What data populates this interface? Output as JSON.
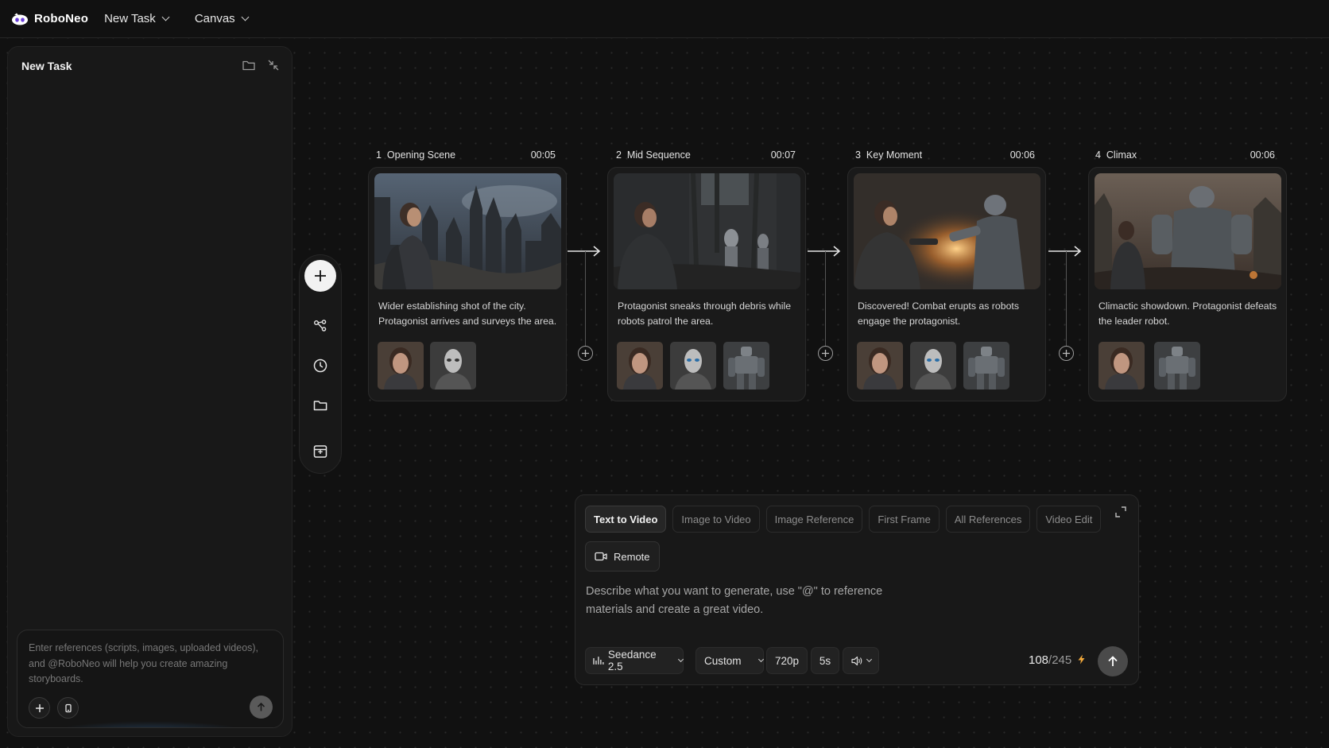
{
  "app": {
    "name": "RoboNeo",
    "menus": [
      {
        "label": "New Task"
      },
      {
        "label": "Canvas"
      }
    ]
  },
  "left_panel": {
    "title": "New Task",
    "composer_placeholder": "Enter references (scripts, images, uploaded videos), and @RoboNeo will help you create amazing storyboards."
  },
  "scenes": [
    {
      "index": "1",
      "title": "Opening Scene",
      "duration": "00:05",
      "description": "Wider establishing shot of the city. Protagonist arrives and surveys the area.",
      "refs": [
        "woman",
        "android"
      ]
    },
    {
      "index": "2",
      "title": "Mid Sequence",
      "duration": "00:07",
      "description": "Protagonist sneaks through debris while robots patrol the area.",
      "refs": [
        "woman",
        "android",
        "mech"
      ]
    },
    {
      "index": "3",
      "title": "Key Moment",
      "duration": "00:06",
      "description": "Discovered! Combat erupts as robots engage the protagonist.",
      "refs": [
        "woman",
        "android",
        "mech"
      ]
    },
    {
      "index": "4",
      "title": "Climax",
      "duration": "00:06",
      "description": "Climactic showdown. Protagonist defeats the leader robot.",
      "refs": [
        "woman",
        "mech"
      ]
    }
  ],
  "generator": {
    "tabs": [
      {
        "label": "Text to Video",
        "active": true
      },
      {
        "label": "Image to Video",
        "active": false
      },
      {
        "label": "Image Reference",
        "active": false
      },
      {
        "label": "First Frame",
        "active": false
      },
      {
        "label": "All References",
        "active": false
      },
      {
        "label": "Video Edit",
        "active": false
      }
    ],
    "remote_label": "Remote",
    "prompt_placeholder": "Describe what you want to generate, use \"@\" to reference materials and create a great video.",
    "model": "Seedance 2.5",
    "ratio": "Custom",
    "resolution": "720p",
    "duration": "5s",
    "credits_used": "108",
    "credits_total": "/245"
  },
  "icons": {
    "rail": [
      "add-icon",
      "workflow-icon",
      "history-icon",
      "folder-icon",
      "storyboard-icon"
    ],
    "accent": "#f2a93b"
  }
}
